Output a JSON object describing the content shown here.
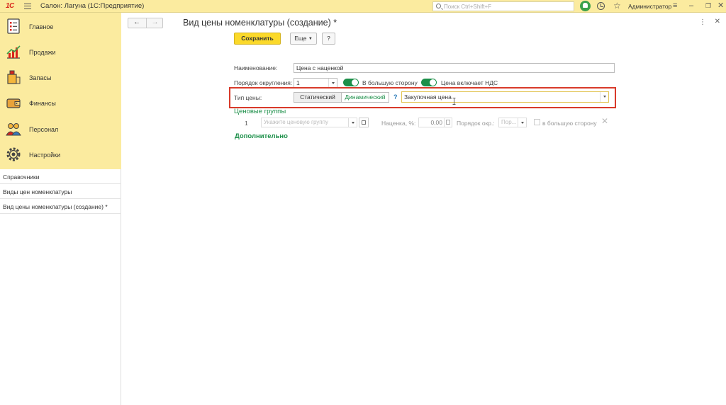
{
  "titlebar": {
    "logo": "1С",
    "app_title": "Салон: Лагуна  (1С:Предприятие)",
    "search_placeholder": "Поиск Ctrl+Shift+F",
    "user_name": "Администратор"
  },
  "sidebar": {
    "sections": [
      {
        "label": "Главное",
        "icon": "list-icon"
      },
      {
        "label": "Продажи",
        "icon": "sales-chart-icon"
      },
      {
        "label": "Запасы",
        "icon": "stock-icon"
      },
      {
        "label": "Финансы",
        "icon": "wallet-icon"
      },
      {
        "label": "Персонал",
        "icon": "people-icon"
      },
      {
        "label": "Настройки",
        "icon": "gear-icon"
      }
    ],
    "nav_links": [
      "Справочники",
      "Виды цен номенклатуры",
      "Вид цены номенклатуры (создание) *"
    ]
  },
  "form": {
    "title": "Вид цены номенклатуры (создание) *",
    "toolbar": {
      "save_label": "Сохранить",
      "more_label": "Еще",
      "help_label": "?"
    },
    "name_label": "Наименование:",
    "name_value": "Цена с наценкой",
    "rounding_label": "Порядок округления:",
    "rounding_value": "1",
    "round_up_label": "В большую сторону",
    "round_up_on": true,
    "vat_label": "Цена включает НДС",
    "vat_on": true,
    "price_type_label": "Тип цены:",
    "price_type_options": [
      "Статический",
      "Динамический"
    ],
    "price_type_selected": "Динамический",
    "price_type_help": "?",
    "base_price_value": "Закупочная цена",
    "price_groups_title": "Ценовые группы",
    "group_row": {
      "number": "1",
      "group_placeholder": "Укажите ценовую группу",
      "markup_label": "Наценка, %:",
      "markup_value": "0,00",
      "rounding_label": "Порядок окр.:",
      "rounding_placeholder": "Пор...",
      "round_up_label": "в большую сторону"
    },
    "additional_label": "Дополнительно"
  },
  "colors": {
    "header_bg": "#fbeb9f",
    "primary_button": "#fbd92a",
    "accent_green": "#1c8f49",
    "highlight_red": "#d83a2a"
  }
}
